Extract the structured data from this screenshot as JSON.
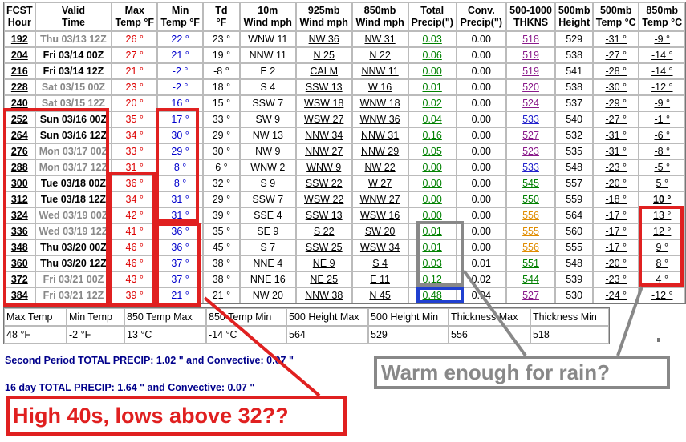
{
  "headers": [
    [
      "FCST",
      "Hour"
    ],
    [
      "Valid",
      "Time"
    ],
    [
      "Max",
      "Temp °F"
    ],
    [
      "Min",
      "Temp °F"
    ],
    [
      "Td",
      "°F"
    ],
    [
      "10m",
      "Wind mph"
    ],
    [
      "925mb",
      "Wind mph"
    ],
    [
      "850mb",
      "Wind mph"
    ],
    [
      "Total",
      "Precip(\")"
    ],
    [
      "Conv.",
      "Precip(\")"
    ],
    [
      "500-1000",
      "THKNS"
    ],
    [
      "500mb",
      "Height"
    ],
    [
      "500mb",
      "Temp °C"
    ],
    [
      "850mb",
      "Temp °C"
    ]
  ],
  "rows": [
    {
      "hour": "192",
      "time": "Thu 03/13 12Z",
      "gray": true,
      "max": "26 °",
      "min": "22 °",
      "td": "23 °",
      "w10": "WNW 11",
      "w925": "NW 36",
      "w850": "NW 31",
      "precip": "0.03",
      "conv": "0.00",
      "thk": "518",
      "thk_color": "purple",
      "hgt": "529",
      "t500": "-31 °",
      "t850": "-9 °"
    },
    {
      "hour": "204",
      "time": "Fri 03/14 00Z",
      "gray": false,
      "max": "27 °",
      "min": "21 °",
      "td": "19 °",
      "w10": "NNW 11",
      "w925": "N 25",
      "w850": "N 22",
      "precip": "0.06",
      "conv": "0.00",
      "thk": "519",
      "thk_color": "purple",
      "hgt": "538",
      "t500": "-27 °",
      "t850": "-14 °"
    },
    {
      "hour": "216",
      "time": "Fri 03/14 12Z",
      "gray": false,
      "max": "21 °",
      "min": "-2 °",
      "td": "-8 °",
      "w10": "E 2",
      "w925": "CALM",
      "w850": "NNW 11",
      "precip": "0.00",
      "conv": "0.00",
      "thk": "519",
      "thk_color": "purple",
      "hgt": "541",
      "t500": "-28 °",
      "t850": "-14 °"
    },
    {
      "hour": "228",
      "time": "Sat 03/15 00Z",
      "gray": true,
      "max": "23 °",
      "min": "-2 °",
      "td": "18 °",
      "w10": "S 4",
      "w925": "SSW 13",
      "w850": "W 16",
      "precip": "0.01",
      "conv": "0.00",
      "thk": "520",
      "thk_color": "purple",
      "hgt": "538",
      "t500": "-30 °",
      "t850": "-12 °"
    },
    {
      "hour": "240",
      "time": "Sat 03/15 12Z",
      "gray": true,
      "max": "20 °",
      "min": "16 °",
      "td": "15 °",
      "w10": "SSW 7",
      "w925": "WSW 18",
      "w850": "WNW 18",
      "precip": "0.02",
      "conv": "0.00",
      "thk": "524",
      "thk_color": "purple",
      "hgt": "537",
      "t500": "-29 °",
      "t850": "-9 °"
    },
    {
      "hour": "252",
      "time": "Sun 03/16 00Z",
      "gray": false,
      "max": "35 °",
      "min": "17 °",
      "td": "33 °",
      "w10": "SW 9",
      "w925": "WSW 27",
      "w850": "WNW 36",
      "precip": "0.04",
      "conv": "0.00",
      "thk": "533",
      "thk_color": "blue",
      "hgt": "540",
      "t500": "-27 °",
      "t850": "-1 °"
    },
    {
      "hour": "264",
      "time": "Sun 03/16 12Z",
      "gray": false,
      "max": "34 °",
      "min": "30 °",
      "td": "29 °",
      "w10": "NW 13",
      "w925": "NNW 34",
      "w850": "NNW 31",
      "precip": "0.16",
      "conv": "0.00",
      "thk": "527",
      "thk_color": "purple",
      "hgt": "532",
      "t500": "-31 °",
      "t850": "-6 °"
    },
    {
      "hour": "276",
      "time": "Mon 03/17 00Z",
      "gray": true,
      "max": "33 °",
      "min": "29 °",
      "td": "30 °",
      "w10": "NW 9",
      "w925": "NNW 27",
      "w850": "NNW 29",
      "precip": "0.05",
      "conv": "0.00",
      "thk": "523",
      "thk_color": "purple",
      "hgt": "535",
      "t500": "-31 °",
      "t850": "-8 °"
    },
    {
      "hour": "288",
      "time": "Mon 03/17 12Z",
      "gray": true,
      "max": "31 °",
      "min": "8 °",
      "td": "6 °",
      "w10": "WNW 2",
      "w925": "WNW 9",
      "w850": "NW 22",
      "precip": "0.00",
      "conv": "0.00",
      "thk": "533",
      "thk_color": "blue",
      "hgt": "548",
      "t500": "-23 °",
      "t850": "-5 °"
    },
    {
      "hour": "300",
      "time": "Tue 03/18 00Z",
      "gray": false,
      "max": "36 °",
      "min": "8 °",
      "td": "32 °",
      "w10": "S 9",
      "w925": "SSW 22",
      "w850": "W 27",
      "precip": "0.00",
      "conv": "0.00",
      "thk": "545",
      "thk_color": "green",
      "hgt": "557",
      "t500": "-20 °",
      "t850": "5 °"
    },
    {
      "hour": "312",
      "time": "Tue 03/18 12Z",
      "gray": false,
      "max": "34 °",
      "min": "31 °",
      "td": "29 °",
      "w10": "SSW 7",
      "w925": "WSW 22",
      "w850": "WNW 27",
      "precip": "0.00",
      "conv": "0.00",
      "thk": "550",
      "thk_color": "green",
      "hgt": "559",
      "t500": "-18 °",
      "t850": "10 °",
      "t850_bold": true
    },
    {
      "hour": "324",
      "time": "Wed 03/19 00Z",
      "gray": true,
      "max": "42 °",
      "min": "31 °",
      "td": "39 °",
      "w10": "SSE 4",
      "w925": "SSW 13",
      "w850": "WSW 16",
      "precip": "0.00",
      "conv": "0.00",
      "thk": "556",
      "thk_color": "orange",
      "hgt": "564",
      "t500": "-17 °",
      "t850": "13 °"
    },
    {
      "hour": "336",
      "time": "Wed 03/19 12Z",
      "gray": true,
      "max": "41 °",
      "min": "36 °",
      "td": "35 °",
      "w10": "SE 9",
      "w925": "S 22",
      "w850": "SW 20",
      "precip": "0.01",
      "conv": "0.00",
      "thk": "555",
      "thk_color": "orange",
      "hgt": "560",
      "t500": "-17 °",
      "t850": "12 °"
    },
    {
      "hour": "348",
      "time": "Thu 03/20 00Z",
      "gray": false,
      "max": "46 °",
      "min": "36 °",
      "td": "45 °",
      "w10": "S 7",
      "w925": "SSW 25",
      "w850": "WSW 34",
      "precip": "0.01",
      "conv": "0.00",
      "thk": "556",
      "thk_color": "orange",
      "hgt": "555",
      "t500": "-17 °",
      "t850": "9 °"
    },
    {
      "hour": "360",
      "time": "Thu 03/20 12Z",
      "gray": false,
      "max": "46 °",
      "min": "37 °",
      "td": "38 °",
      "w10": "NNE 4",
      "w925": "NE 9",
      "w850": "S 4",
      "precip": "0.03",
      "conv": "0.01",
      "thk": "551",
      "thk_color": "green",
      "hgt": "548",
      "t500": "-20 °",
      "t850": "8 °"
    },
    {
      "hour": "372",
      "time": "Fri 03/21 00Z",
      "gray": true,
      "max": "43 °",
      "min": "37 °",
      "td": "38 °",
      "w10": "NNE 16",
      "w925": "NE 25",
      "w850": "E 11",
      "precip": "0.12",
      "conv": "0.02",
      "thk": "544",
      "thk_color": "green",
      "hgt": "539",
      "t500": "-23 °",
      "t850": "4 °"
    },
    {
      "hour": "384",
      "time": "Fri 03/21 12Z",
      "gray": true,
      "max": "39 °",
      "min": "21 °",
      "td": "21 °",
      "w10": "NW 20",
      "w925": "NNW 38",
      "w850": "N 45",
      "precip": "0.48",
      "conv": "0.04",
      "thk": "527",
      "thk_color": "purple",
      "hgt": "530",
      "t500": "-24 °",
      "t850": "-12 °"
    }
  ],
  "summary": {
    "labels": [
      "Max Temp",
      "Min Temp",
      "850 Temp Max",
      "850 Temp Min",
      "500 Height Max",
      "500 Height Min",
      "Thickness Max",
      "Thickness Min"
    ],
    "values": [
      "48 °F",
      "-2 °F",
      "13 °C",
      "-14 °C",
      "564",
      "529",
      "556",
      "518"
    ]
  },
  "lines": {
    "second_period": "Second Period TOTAL PRECIP: 1.02 \" and Convective: 0.07 \"",
    "sixteen_day": "16 day TOTAL PRECIP: 1.64 \" and Convective: 0.07 \""
  },
  "annotations": {
    "high_lows": "High 40s, lows above 32??",
    "warm_rain": "Warm enough for rain?"
  },
  "colors": {
    "max_temp": "#dd0000",
    "min_temp": "#0000cc",
    "annotation_red": "#e02020",
    "annotation_gray": "#888888",
    "annotation_blue": "#2040d0",
    "summary_text": "#00008b"
  }
}
